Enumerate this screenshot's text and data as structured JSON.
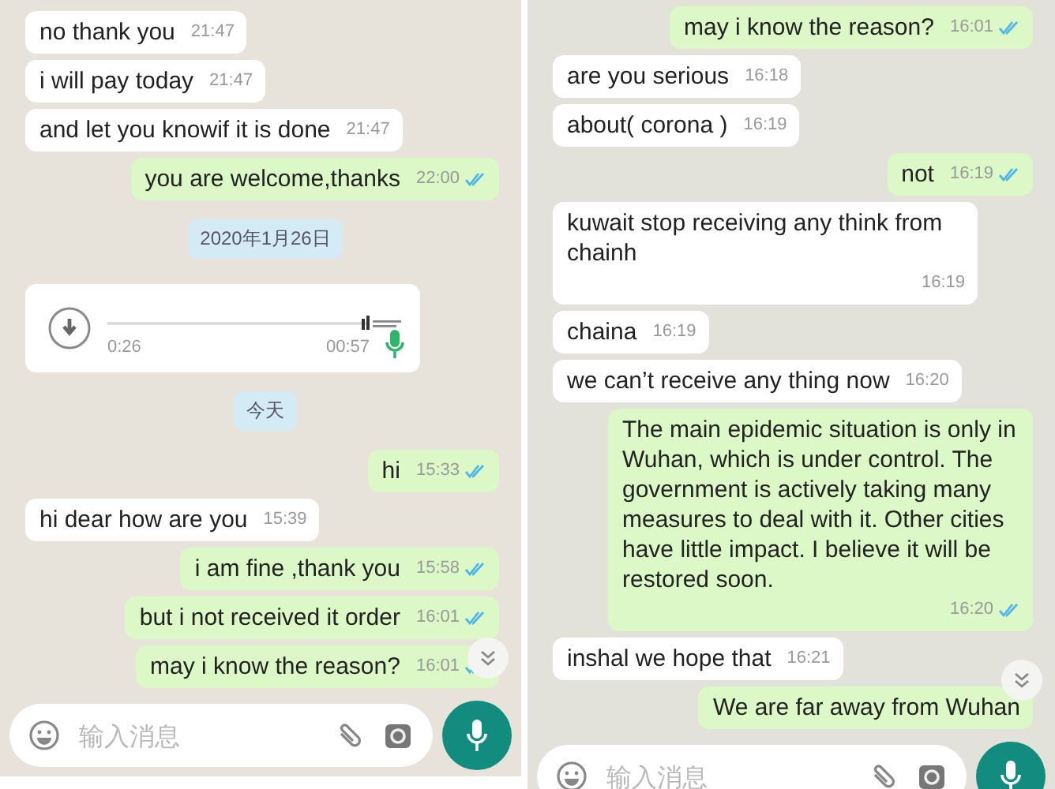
{
  "panels": [
    {
      "messages": [
        {
          "kind": "in",
          "text": "no thank you",
          "time": "21:47"
        },
        {
          "kind": "in",
          "text": "i will pay today",
          "time": "21:47"
        },
        {
          "kind": "in",
          "text": "and let you knowif it is done",
          "time": "21:47"
        },
        {
          "kind": "out",
          "text": "you are welcome,thanks",
          "time": "22:00"
        },
        {
          "kind": "date",
          "text": "2020年1月26日"
        },
        {
          "kind": "voice",
          "elapsed": "0:26",
          "duration": "00:57"
        },
        {
          "kind": "date",
          "text": "今天"
        },
        {
          "kind": "out",
          "text": "hi",
          "time": "15:33"
        },
        {
          "kind": "in",
          "text": "hi dear how are you",
          "time": "15:39"
        },
        {
          "kind": "out",
          "text": "i am fine ,thank you",
          "time": "15:58"
        },
        {
          "kind": "out",
          "text": "but i not received it order",
          "time": "16:01"
        },
        {
          "kind": "out",
          "text": "may i know the reason?",
          "time": "16:01"
        }
      ],
      "input": {
        "placeholder": "输入消息"
      }
    },
    {
      "messages": [
        {
          "kind": "out",
          "text": "may i know the reason?",
          "time": "16:01"
        },
        {
          "kind": "in",
          "text": "are you serious",
          "time": "16:18"
        },
        {
          "kind": "in",
          "text": "about( corona )",
          "time": "16:19"
        },
        {
          "kind": "out",
          "text": "not",
          "time": "16:19"
        },
        {
          "kind": "in",
          "text": "kuwait stop receiving any think from chainh",
          "time": "16:19"
        },
        {
          "kind": "in",
          "text": "chaina",
          "time": "16:19"
        },
        {
          "kind": "in",
          "text": "we can’t receive any thing now",
          "time": "16:20"
        },
        {
          "kind": "out",
          "text": "The main epidemic situation is only in Wuhan, which is under control. The government is actively taking many measures to deal with it. Other cities have little impact. I believe it will be restored soon.",
          "time": "16:20"
        },
        {
          "kind": "in",
          "text": "inshal we hope that",
          "time": "16:21"
        },
        {
          "kind": "out",
          "text": "We are far away from Wuhan"
        }
      ],
      "input": {
        "placeholder": "输入消息"
      }
    }
  ]
}
